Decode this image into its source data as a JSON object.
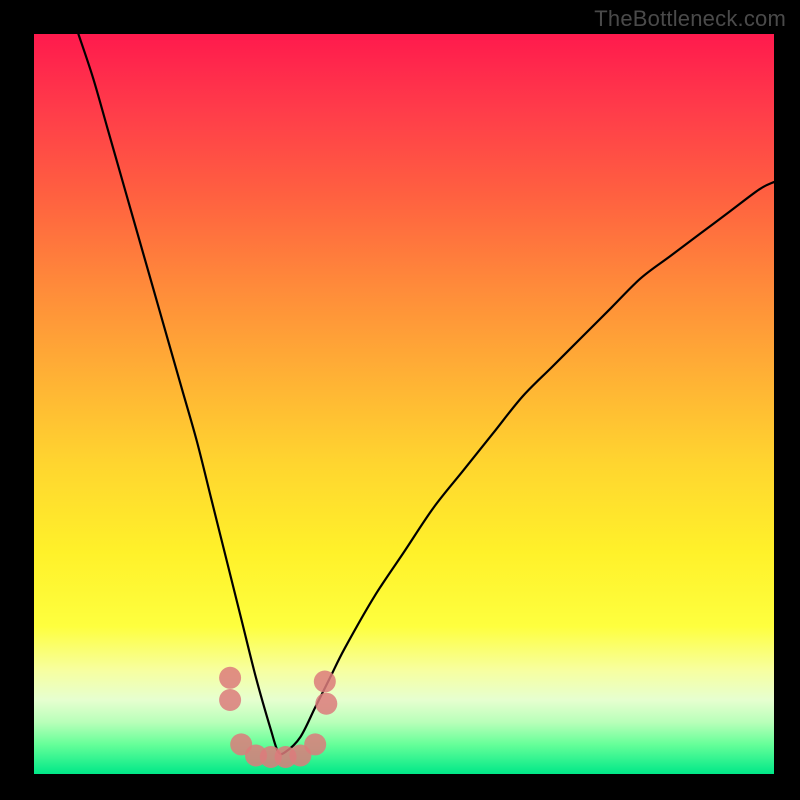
{
  "attribution": "TheBottleneck.com",
  "chart_data": {
    "type": "line",
    "title": "",
    "xlabel": "",
    "ylabel": "",
    "xlim": [
      0,
      100
    ],
    "ylim": [
      0,
      100
    ],
    "series": [
      {
        "name": "curve",
        "x": [
          6,
          8,
          10,
          12,
          14,
          16,
          18,
          20,
          22,
          24,
          26,
          28,
          30,
          32,
          33,
          34,
          36,
          38,
          40,
          42,
          46,
          50,
          54,
          58,
          62,
          66,
          70,
          74,
          78,
          82,
          86,
          90,
          94,
          98,
          100
        ],
        "y": [
          100,
          94,
          87,
          80,
          73,
          66,
          59,
          52,
          45,
          37,
          29,
          21,
          13,
          6,
          3,
          3,
          5,
          9,
          13,
          17,
          24,
          30,
          36,
          41,
          46,
          51,
          55,
          59,
          63,
          67,
          70,
          73,
          76,
          79,
          80
        ]
      }
    ],
    "points": [
      {
        "x": 26.5,
        "y": 13.0
      },
      {
        "x": 26.5,
        "y": 10.0
      },
      {
        "x": 28.0,
        "y": 4.0
      },
      {
        "x": 30.0,
        "y": 2.5
      },
      {
        "x": 32.0,
        "y": 2.3
      },
      {
        "x": 34.0,
        "y": 2.3
      },
      {
        "x": 36.0,
        "y": 2.5
      },
      {
        "x": 38.0,
        "y": 4.0
      },
      {
        "x": 39.5,
        "y": 9.5
      },
      {
        "x": 39.3,
        "y": 12.5
      }
    ],
    "background_gradient": {
      "top": "#ff1a4d",
      "upper_mid": "#ff8a3a",
      "mid": "#ffd52f",
      "lower_mid": "#feff3e",
      "bottom": "#00e888"
    }
  }
}
